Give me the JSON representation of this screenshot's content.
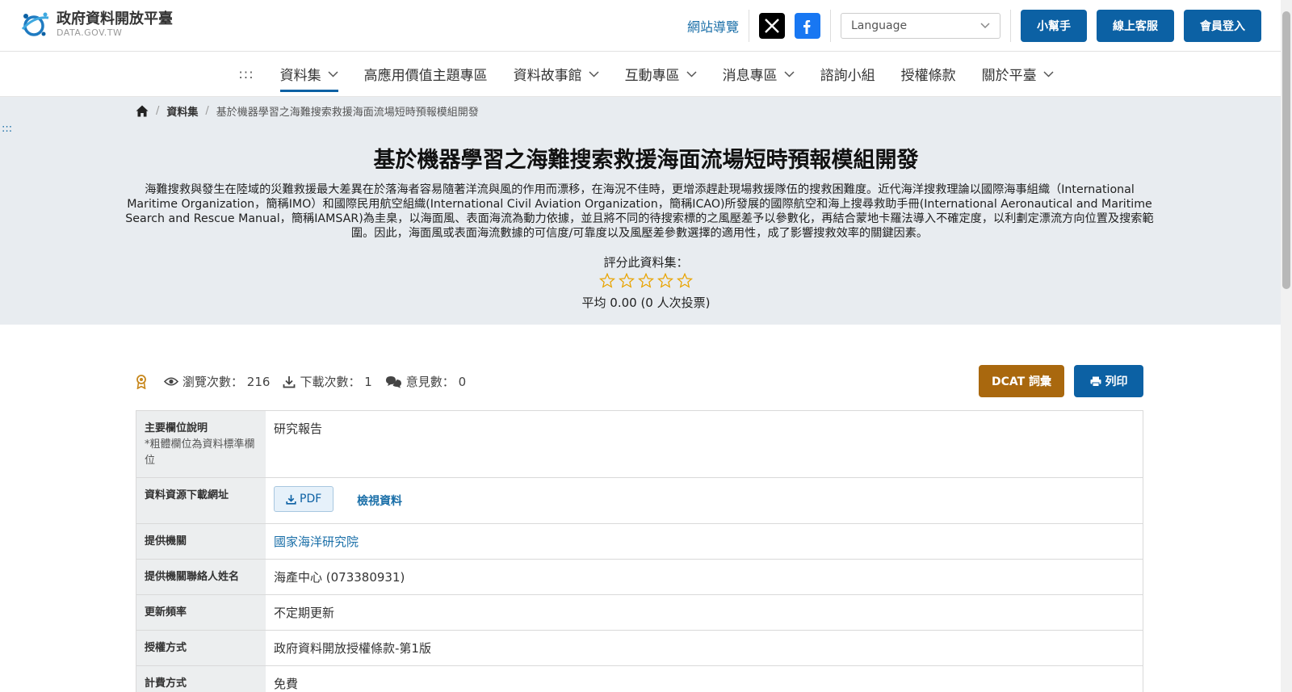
{
  "header": {
    "logo_title": "政府資料開放平臺",
    "logo_sub": "DATA.GOV.TW",
    "sitemap": "網站導覽",
    "language_placeholder": "Language",
    "buttons": [
      "小幫手",
      "線上客服",
      "會員登入"
    ]
  },
  "nav": {
    "accesskey": ":::",
    "items": [
      {
        "label": "資料集",
        "dropdown": true,
        "active": true
      },
      {
        "label": "高應用價值主題專區",
        "dropdown": false
      },
      {
        "label": "資料故事館",
        "dropdown": true
      },
      {
        "label": "互動專區",
        "dropdown": true
      },
      {
        "label": "消息專區",
        "dropdown": true
      },
      {
        "label": "諮詢小組",
        "dropdown": false
      },
      {
        "label": "授權條款",
        "dropdown": false
      },
      {
        "label": "關於平臺",
        "dropdown": true
      }
    ]
  },
  "breadcrumb": {
    "section": "資料集",
    "current": "基於機器學習之海難搜索救援海面流場短時預報模組開發"
  },
  "side_accesskey": ":::",
  "dataset": {
    "title": "基於機器學習之海難搜索救援海面流場短時預報模組開發",
    "description": "海難搜救與發生在陸域的災難救援最大差異在於落海者容易隨著洋流與風的作用而漂移，在海況不佳時，更增添趕赴現場救援隊伍的搜救困難度。近代海洋搜救理論以國際海事組織（International Maritime Organization，簡稱IMO）和國際民用航空組織(International Civil Aviation Organization，簡稱ICAO)所發展的國際航空和海上搜尋救助手冊(International Aeronautical and Maritime Search and Rescue Manual，簡稱IAMSAR)為圭臬，以海面風、表面海流為動力依據，並且將不同的待搜索標的之風壓差予以參數化，再結合蒙地卡羅法導入不確定度，以利劃定漂流方向位置及搜索範圍。因此，海面風或表面海流數據的可信度/可靠度以及風壓差參數選擇的適用性，成了影響搜救效率的關鍵因素。",
    "rate_label": "評分此資料集：",
    "rating_filled": 0,
    "rating_max": 5,
    "average_text": "平均 0.00 (0 人次投票)"
  },
  "stats": {
    "views_label": "瀏覽次數：",
    "views": "216",
    "downloads_label": "下載次數：",
    "downloads": "1",
    "comments_label": "意見數：",
    "comments": "0"
  },
  "actions": {
    "dcat": "DCAT 詞彙",
    "print": "列印"
  },
  "table": {
    "rows": [
      {
        "label": "主要欄位說明",
        "note": "*粗體欄位為資料標準欄位",
        "value": "研究報告"
      },
      {
        "label": "資料資源下載網址",
        "pdf": "PDF",
        "view": "檢視資料"
      },
      {
        "label": "提供機關",
        "value": "國家海洋研究院",
        "link": true
      },
      {
        "label": "提供機關聯絡人姓名",
        "value": "海產中心 (073380931)"
      },
      {
        "label": "更新頻率",
        "value": "不定期更新"
      },
      {
        "label": "授權方式",
        "value": "政府資料開放授權條款-第1版"
      },
      {
        "label": "計費方式",
        "value": "免費"
      }
    ]
  },
  "colors": {
    "primary": "#0c61a4",
    "dcat": "#a9680e",
    "hero_bg": "#e8ecf0",
    "star": "#e8a300"
  }
}
